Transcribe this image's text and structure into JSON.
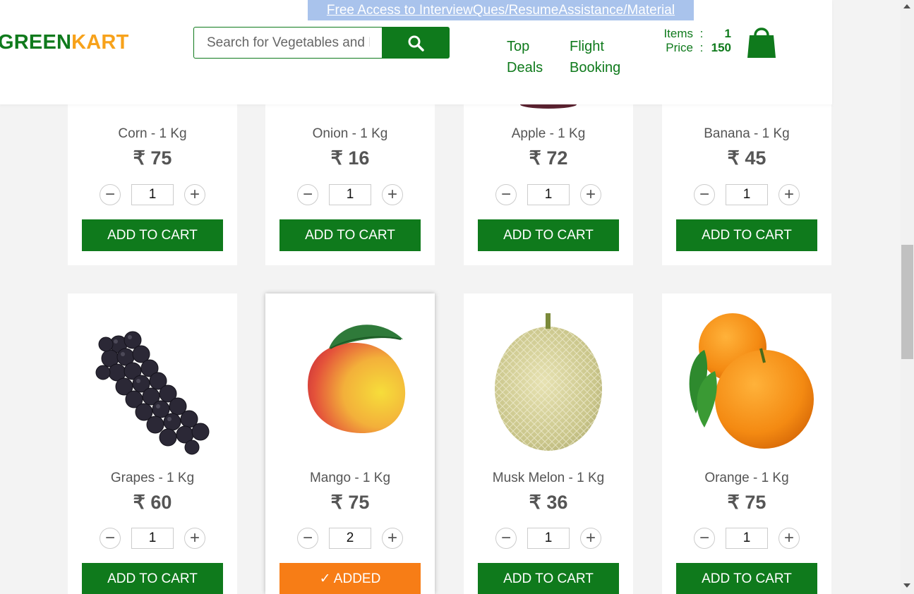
{
  "header": {
    "promo": "Free Access to InterviewQues/ResumeAssistance/Material",
    "brand_green": "GREEN",
    "brand_orange": "KART",
    "search_placeholder": "Search for Vegetables and Fruits",
    "nav": [
      {
        "line1": "Top",
        "line2": "Deals"
      },
      {
        "line1": "Flight",
        "line2": "Booking"
      }
    ],
    "cart": {
      "items_label": "Items",
      "items_sep": ":",
      "items_value": "1",
      "price_label": "Price",
      "price_sep": ":",
      "price_value": "150"
    }
  },
  "products": [
    {
      "name": "Corn - 1 Kg",
      "price": "₹ 75",
      "qty": "1",
      "button": "ADD TO CART"
    },
    {
      "name": "Onion - 1 Kg",
      "price": "₹ 16",
      "qty": "1",
      "button": "ADD TO CART"
    },
    {
      "name": "Apple - 1 Kg",
      "price": "₹ 72",
      "qty": "1",
      "button": "ADD TO CART"
    },
    {
      "name": "Banana - 1 Kg",
      "price": "₹ 45",
      "qty": "1",
      "button": "ADD TO CART"
    },
    {
      "name": "Grapes - 1 Kg",
      "price": "₹ 60",
      "qty": "1",
      "button": "ADD TO CART"
    },
    {
      "name": "Mango - 1 Kg",
      "price": "₹ 75",
      "qty": "2",
      "button": "✓ ADDED"
    },
    {
      "name": "Musk Melon - 1 Kg",
      "price": "₹ 36",
      "qty": "1",
      "button": "ADD TO CART"
    },
    {
      "name": "Orange - 1 Kg",
      "price": "₹ 75",
      "qty": "1",
      "button": "ADD TO CART"
    }
  ],
  "stepper": {
    "minus": "−",
    "plus": "+"
  },
  "colors": {
    "brand_green": "#0f7a1c",
    "brand_orange": "#f7a21b",
    "added_orange": "#f77d16",
    "promo_bg": "#a9c3ec"
  }
}
